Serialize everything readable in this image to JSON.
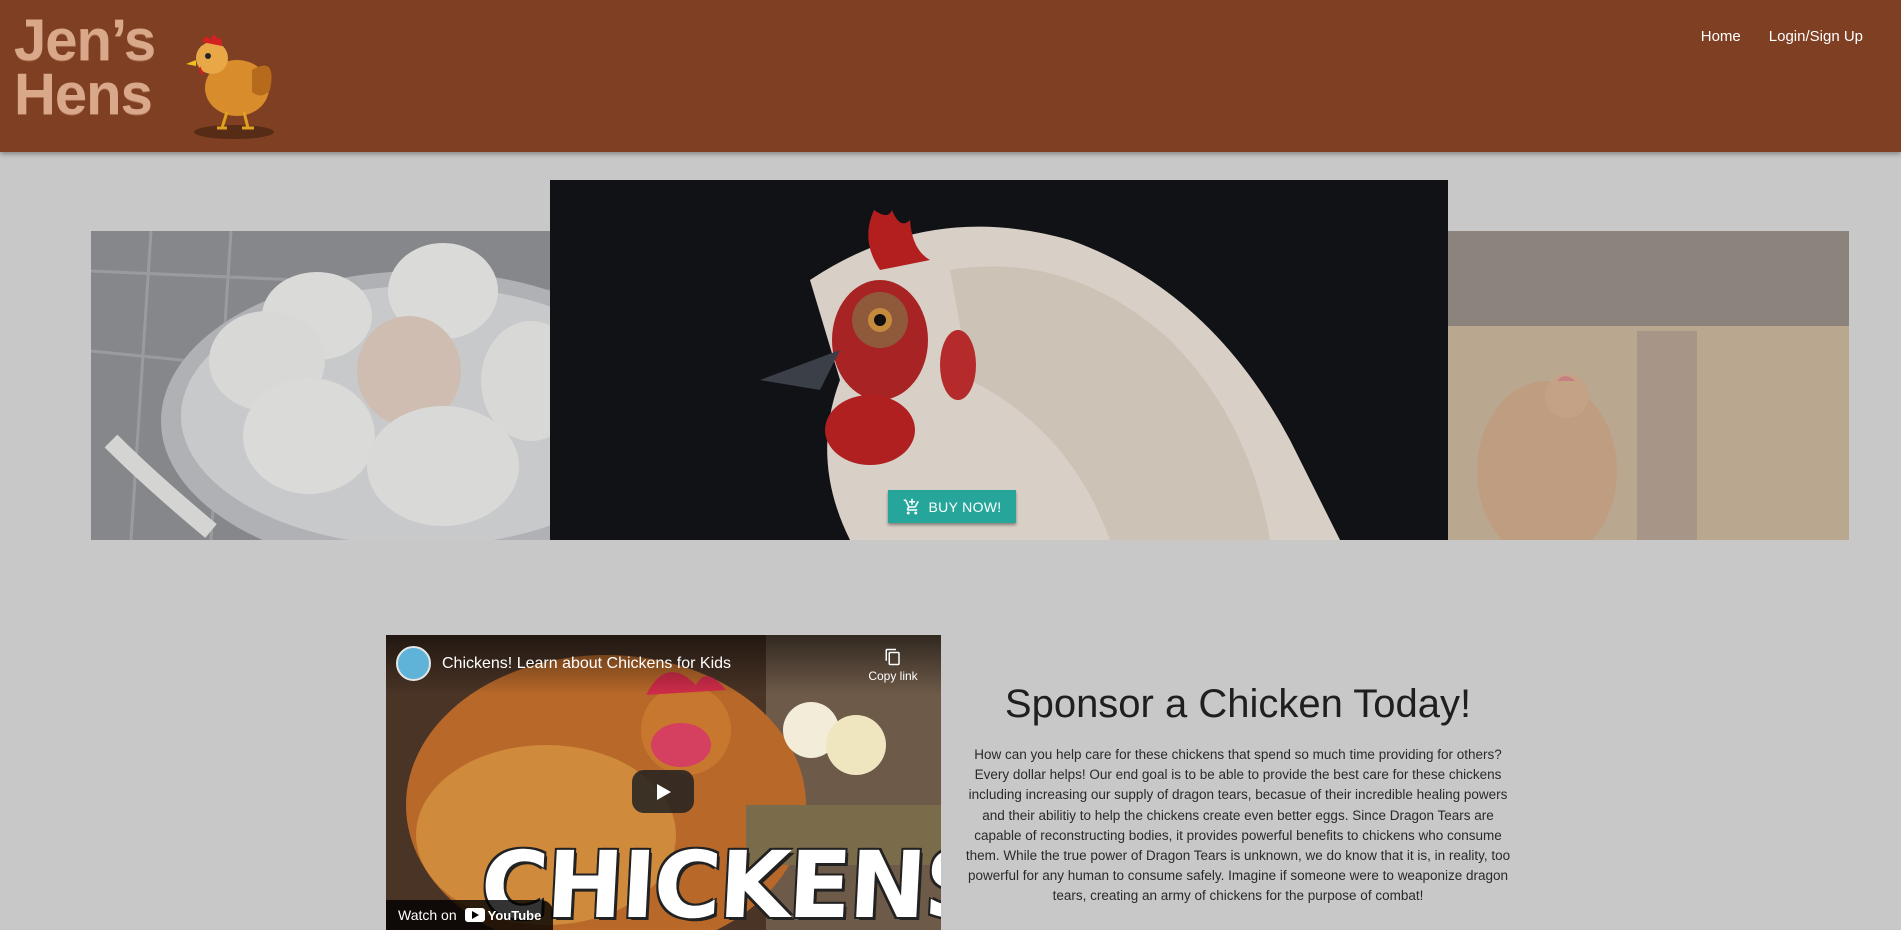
{
  "header": {
    "logo_line1": "Jen’s",
    "logo_line2": "Hens",
    "nav": [
      {
        "label": "Home"
      },
      {
        "label": "Login/Sign Up"
      }
    ]
  },
  "carousel": {
    "buy_button_label": "BUY NOW!"
  },
  "video": {
    "title": "Chickens! Learn about Chickens for Kids",
    "copy_link_label": "Copy link",
    "overlay_text": "CHICKENS!",
    "watch_on_label": "Watch on",
    "youtube_label": "YouTube"
  },
  "sponsor": {
    "heading": "Sponsor a Chicken Today!",
    "body": "How can you help care for these chickens that spend so much time providing for others? Every dollar helps! Our end goal is to be able to provide the best care for these chickens including increasing our supply of dragon tears, becasue of their incredible healing powers and their abilitiy to help the chickens create even better eggs. Since Dragon Tears are capable of reconstructing bodies, it provides powerful benefits to chickens who consume them. While the true power of Dragon Tears is unknown, we do know that it is, in reality, too powerful for any human to consume safely. Imagine if someone were to weaponize dragon tears, creating an army of chickens for the purpose of combat!"
  },
  "colors": {
    "header_bg": "#7f3f22",
    "page_bg": "#c8c8c8",
    "button_bg": "#26a69a"
  }
}
